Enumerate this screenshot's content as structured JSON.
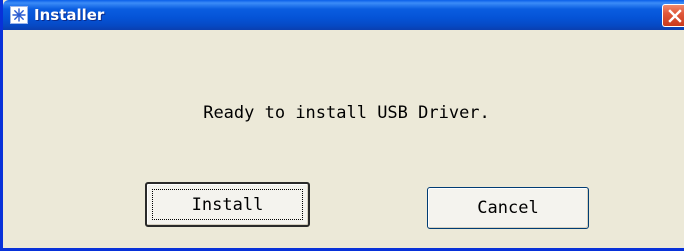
{
  "window": {
    "title": "Installer",
    "icon": "snowflake-icon",
    "close": "close-icon"
  },
  "dialog": {
    "message": "Ready to install USB Driver.",
    "install_label": "Install",
    "cancel_label": "Cancel"
  },
  "colors": {
    "titlebar": "#0a5de0",
    "dialog_bg": "#ece9d8",
    "close_button": "#e0583a"
  }
}
